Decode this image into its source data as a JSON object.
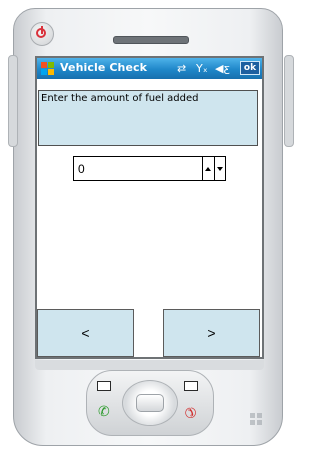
{
  "window": {
    "title": "Vehicle Check",
    "ok_label": "ok"
  },
  "status_icons": [
    "connectivity-icon",
    "signal-off-icon",
    "volume-icon"
  ],
  "prompt": {
    "text": "Enter the amount of fuel added"
  },
  "fuel_input": {
    "value": "0"
  },
  "navigation": {
    "prev_label": "<",
    "next_label": ">"
  },
  "colors": {
    "titlebar": "#1f87c9",
    "panel_fill": "#cfe5ee",
    "power_accent": "#d9323c",
    "call_green": "#2a9a2a",
    "call_red": "#d23232"
  }
}
